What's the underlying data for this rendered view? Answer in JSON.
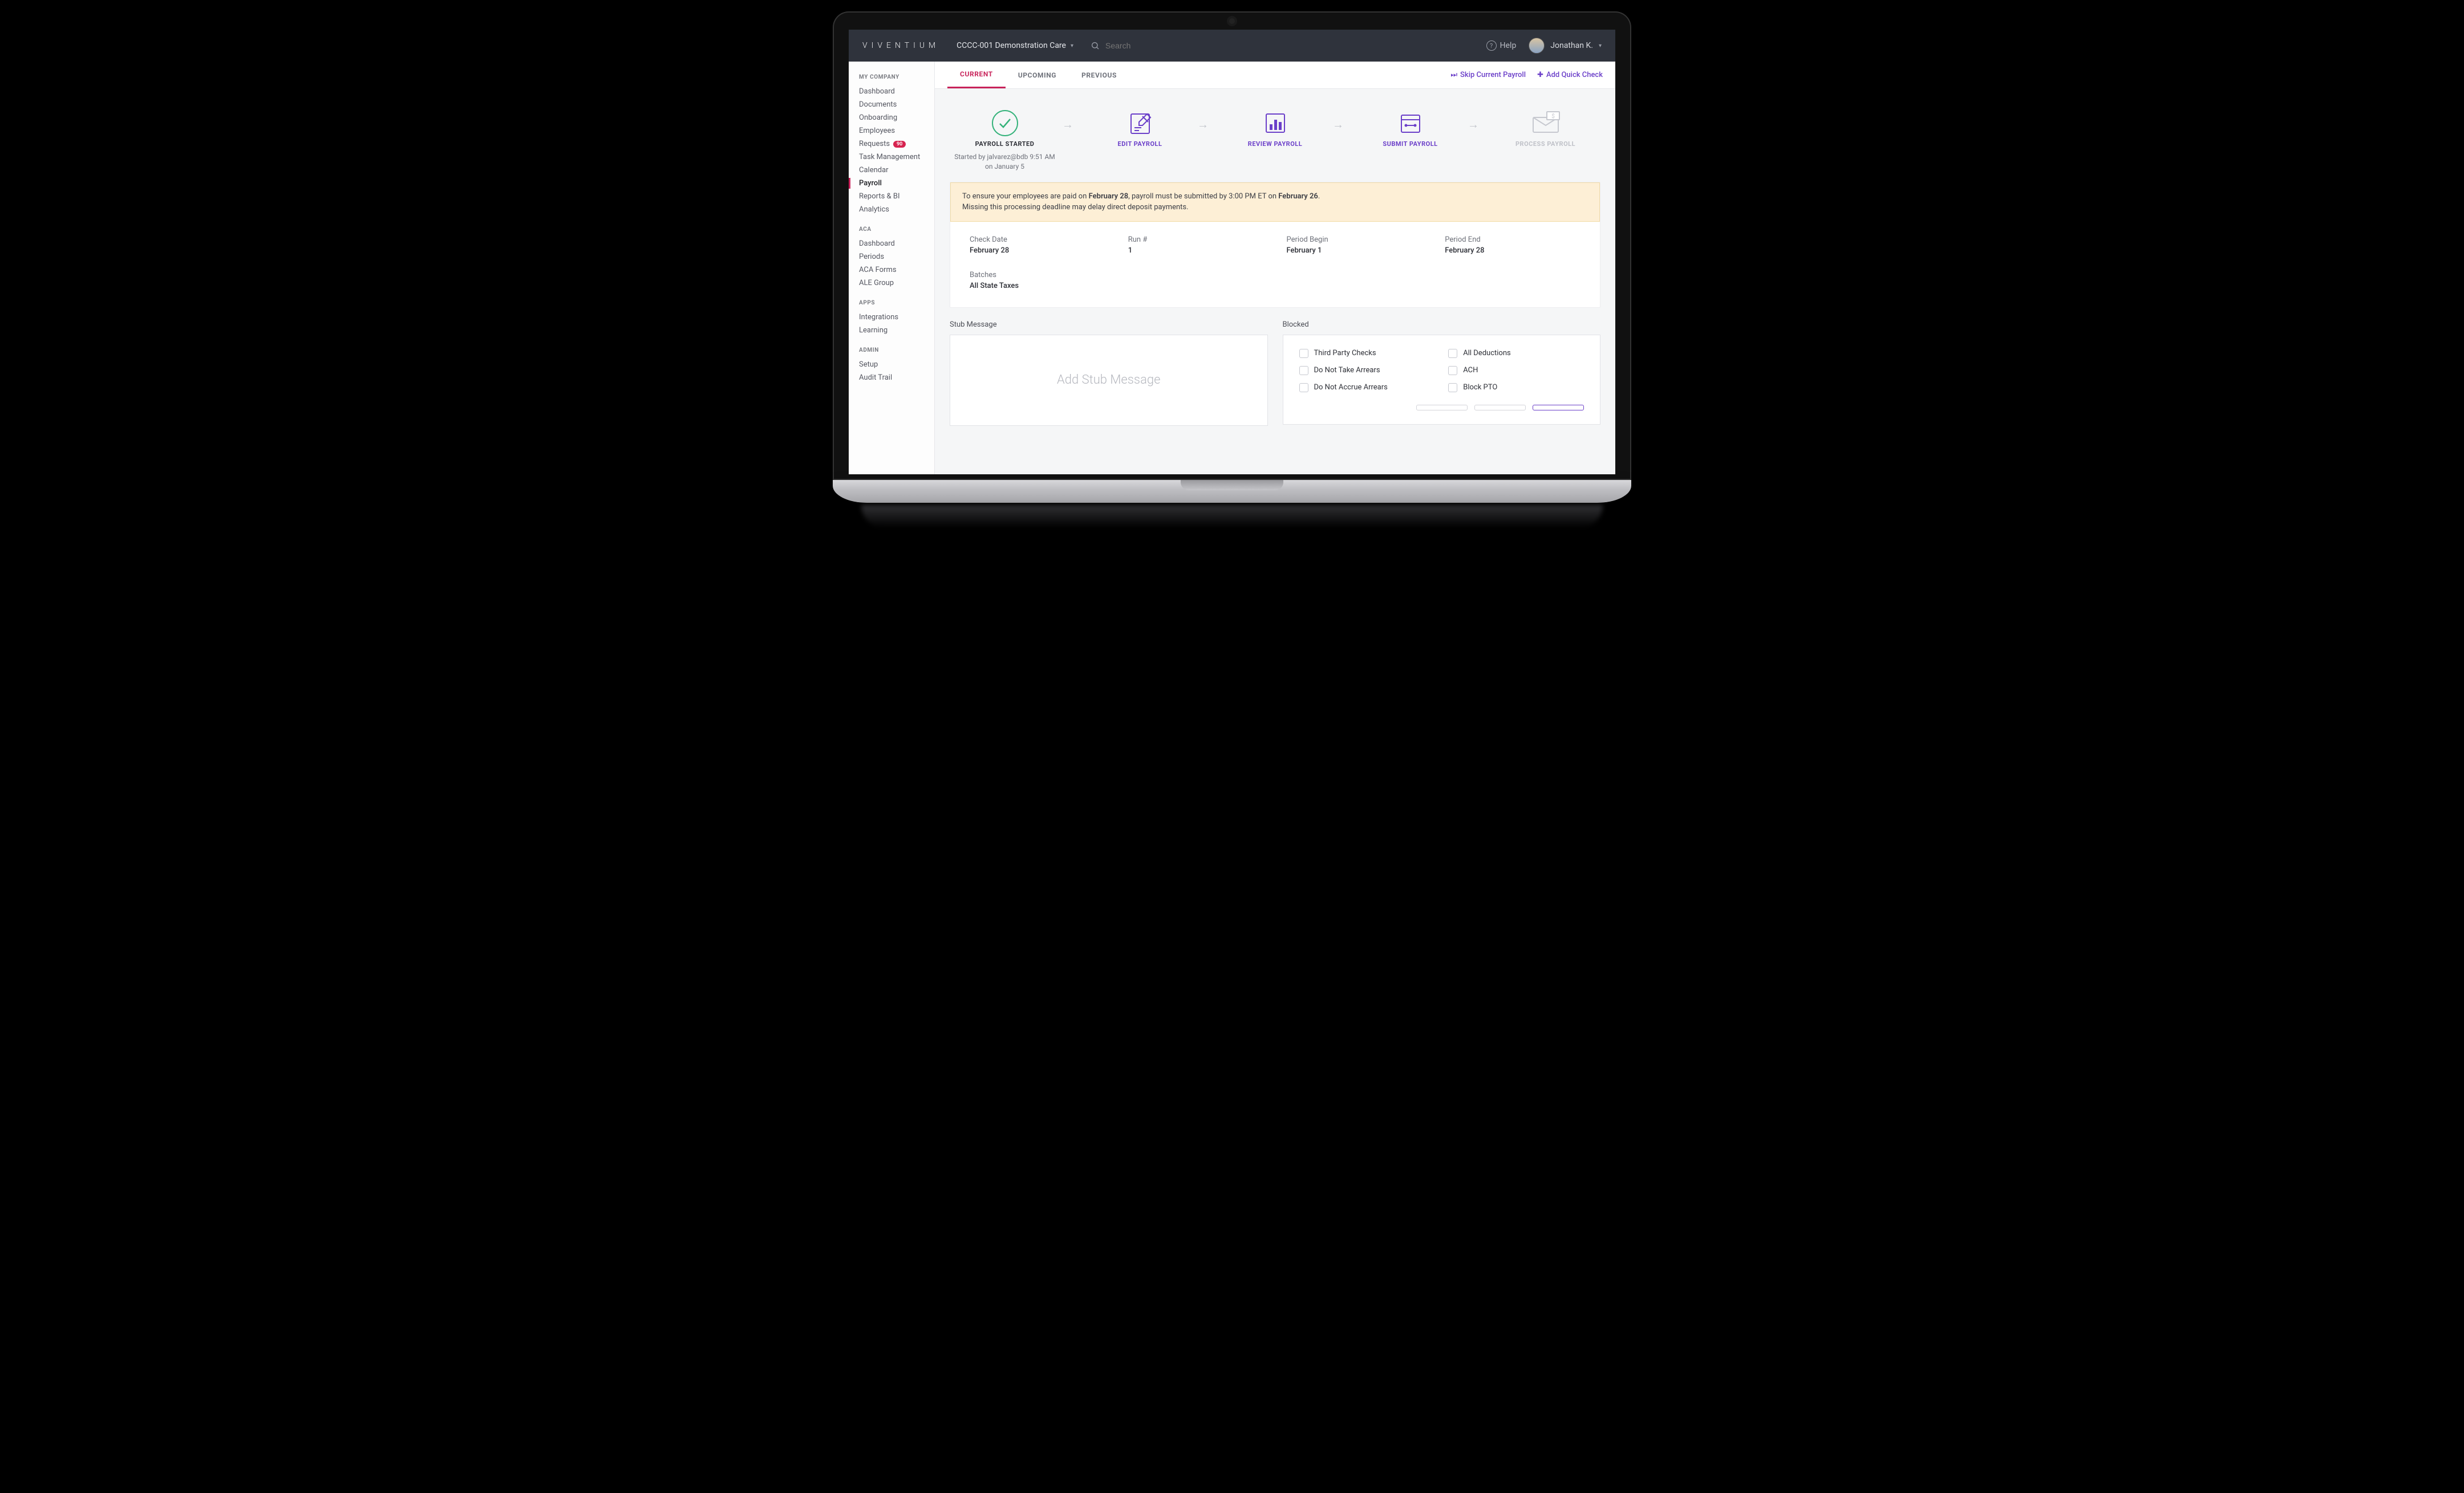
{
  "brand": "VIVENTIUM",
  "org": "CCCC-001 Demonstration Care",
  "search_placeholder": "Search",
  "help_label": "Help",
  "user_name": "Jonathan K.",
  "sidebar": {
    "sections": [
      {
        "title": "MY COMPANY",
        "items": [
          {
            "label": "Dashboard"
          },
          {
            "label": "Documents"
          },
          {
            "label": "Onboarding"
          },
          {
            "label": "Employees"
          },
          {
            "label": "Requests",
            "badge": "90"
          },
          {
            "label": "Task Management"
          },
          {
            "label": "Calendar"
          },
          {
            "label": "Payroll",
            "active": true
          },
          {
            "label": "Reports & BI"
          },
          {
            "label": "Analytics"
          }
        ]
      },
      {
        "title": "ACA",
        "items": [
          {
            "label": "Dashboard"
          },
          {
            "label": "Periods"
          },
          {
            "label": "ACA Forms"
          },
          {
            "label": "ALE Group"
          }
        ]
      },
      {
        "title": "APPS",
        "items": [
          {
            "label": "Integrations"
          },
          {
            "label": "Learning"
          }
        ]
      },
      {
        "title": "ADMIN",
        "items": [
          {
            "label": "Setup"
          },
          {
            "label": "Audit Trail"
          }
        ]
      }
    ]
  },
  "tabs": {
    "current": "CURRENT",
    "upcoming": "UPCOMING",
    "previous": "PREVIOUS"
  },
  "actions": {
    "skip": "Skip Current Payroll",
    "addqc": "Add Quick Check"
  },
  "steps": {
    "started": {
      "label": "PAYROLL STARTED",
      "sub1": "Started by jalvarez@bdb 9:51 AM",
      "sub2": "on January 5"
    },
    "edit": {
      "label": "EDIT PAYROLL"
    },
    "review": {
      "label": "REVIEW PAYROLL"
    },
    "submit": {
      "label": "SUBMIT PAYROLL"
    },
    "process": {
      "label": "PROCESS PAYROLL"
    }
  },
  "notice": {
    "t1": "To ensure your employees are paid on ",
    "d1": "February 28",
    "t2": ", payroll must be submitted by 3:00 PM ET on ",
    "d2": "February 26",
    "t3": ".",
    "line2": "Missing this processing deadline may delay direct deposit payments."
  },
  "summary": {
    "check_date": {
      "label": "Check Date",
      "value": "February 28"
    },
    "run": {
      "label": "Run #",
      "value": "1"
    },
    "period_begin": {
      "label": "Period Begin",
      "value": "February 1"
    },
    "period_end": {
      "label": "Period End",
      "value": "February 28"
    },
    "batches": {
      "label": "Batches",
      "value": "All State Taxes"
    }
  },
  "stub": {
    "title": "Stub Message",
    "placeholder": "Add Stub Message"
  },
  "blocked": {
    "title": "Blocked",
    "items": [
      "Third Party Checks",
      "All Deductions",
      "Do Not Take Arrears",
      "ACH",
      "Do Not Accrue Arrears",
      "Block PTO"
    ]
  },
  "colors": {
    "accent": "#c8235a",
    "brand_purple": "#6b3fc9",
    "success": "#34b27a"
  }
}
